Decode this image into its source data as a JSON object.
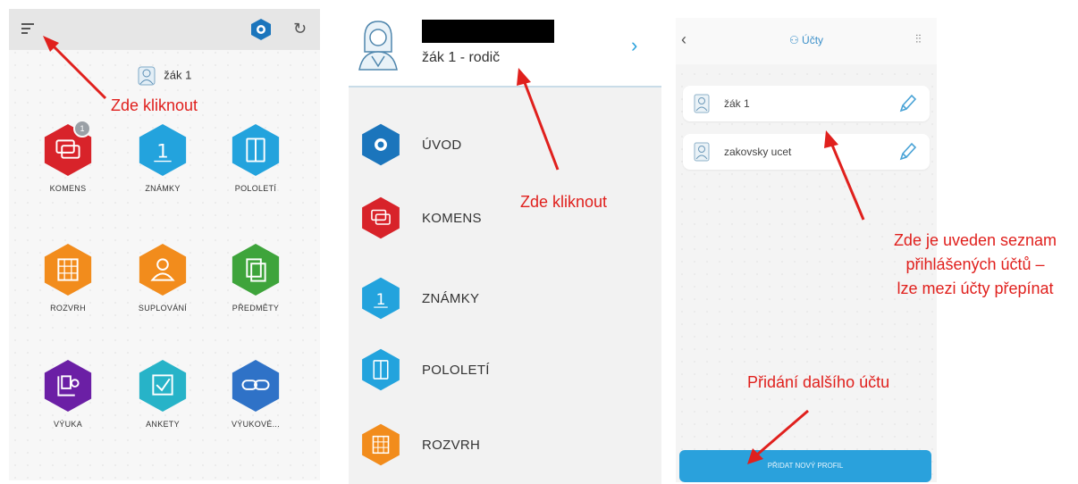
{
  "panel1": {
    "user_label": "žák 1",
    "badge_count": "1",
    "tiles": [
      {
        "label": "KOMENS",
        "color": "#d8232a",
        "icon": "chat-icon"
      },
      {
        "label": "ZNÁMKY",
        "color": "#23a3dd",
        "icon": "grade-icon"
      },
      {
        "label": "POLOLETÍ",
        "color": "#23a3dd",
        "icon": "book-icon"
      },
      {
        "label": "ROZVRH",
        "color": "#f28c1c",
        "icon": "calendar-icon"
      },
      {
        "label": "SUPLOVÁNÍ",
        "color": "#f28c1c",
        "icon": "person-icon"
      },
      {
        "label": "PŘEDMĚTY",
        "color": "#3ea43b",
        "icon": "subjects-icon"
      },
      {
        "label": "VÝUKA",
        "color": "#6b1fa5",
        "icon": "lesson-icon"
      },
      {
        "label": "ANKETY",
        "color": "#27b3c8",
        "icon": "checkbox-icon"
      },
      {
        "label": "VÝUKOVÉ...",
        "color": "#2f72c7",
        "icon": "link-icon"
      }
    ]
  },
  "panel2": {
    "parent_label": "žák 1 - rodič",
    "menu": [
      {
        "label": "ÚVOD",
        "color": "#1b75bc",
        "icon": "bakalari-logo-icon"
      },
      {
        "label": "KOMENS",
        "color": "#d8232a",
        "icon": "chat-icon"
      },
      {
        "label": "ZNÁMKY",
        "color": "#23a3dd",
        "icon": "grade-icon"
      },
      {
        "label": "POLOLETÍ",
        "color": "#23a3dd",
        "icon": "book-icon"
      },
      {
        "label": "ROZVRH",
        "color": "#f28c1c",
        "icon": "calendar-icon"
      }
    ]
  },
  "panel3": {
    "title": "Účty",
    "accounts": [
      {
        "name": "žák 1"
      },
      {
        "name": "zakovsky ucet"
      }
    ],
    "add_button": "PŘIDAT NOVÝ PROFIL"
  },
  "annotations": {
    "click_here_1": "Zde kliknout",
    "click_here_2": "Zde kliknout",
    "accounts_list_line1": "Zde je uveden seznam",
    "accounts_list_line2": "přihlášených účtů –",
    "accounts_list_line3": "lze mezi účty přepínat",
    "add_account": "Přidání dalšího účtu"
  },
  "colors": {
    "accent": "#2aa1dc",
    "annotation": "#e0201d"
  }
}
